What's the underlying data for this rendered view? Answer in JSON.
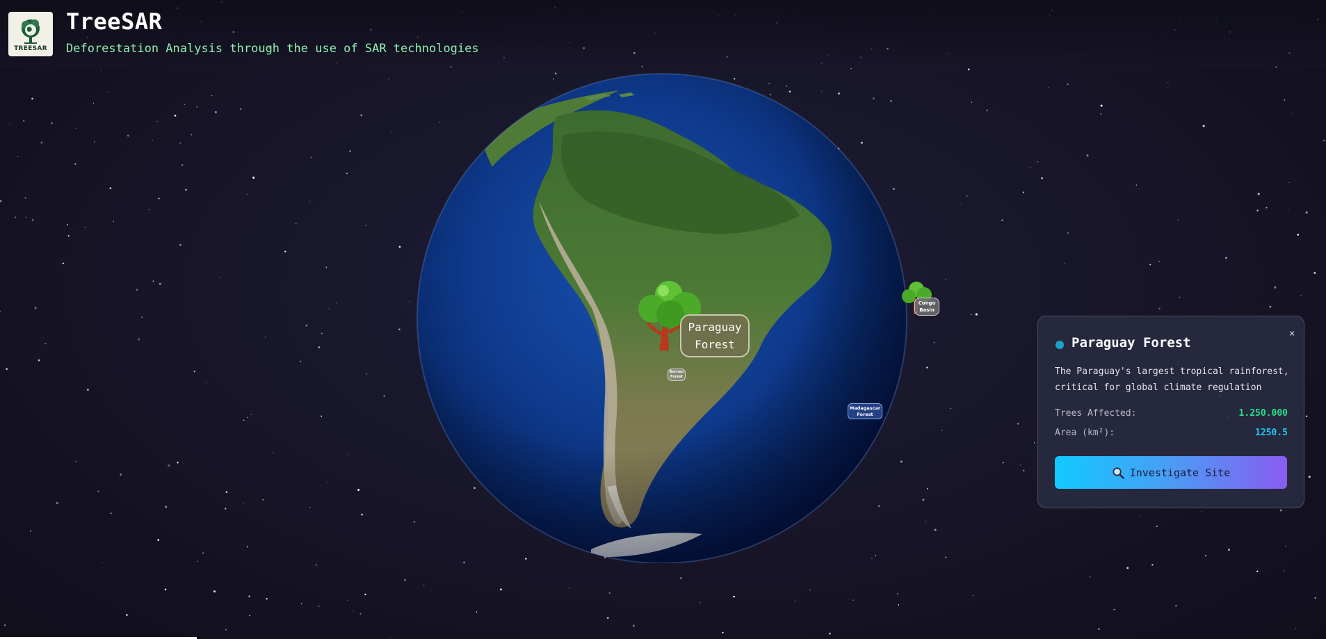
{
  "header": {
    "logo_text": "TREESAR",
    "title": "TreeSAR",
    "subtitle": "Deforestation Analysis through the use of SAR technologies"
  },
  "globe": {
    "labels": {
      "paraguay": "Paraguay\nForest",
      "borneo": "Borneo\nForest",
      "congo": "Congo\nBasin",
      "madagascar": "Madagascar\nForest"
    }
  },
  "panel": {
    "title": "Paraguay Forest",
    "close": "×",
    "description": "The Paraguay's largest tropical rainforest, critical for global climate regulation",
    "trees_label": "Trees Affected:",
    "trees_value": "1.250.000",
    "area_label": "Area (km²):",
    "area_value": "1250.5",
    "button_label": "Investigate Site",
    "button_icon": "magnifier-icon"
  },
  "colors": {
    "accent_green": "#24e08a",
    "accent_cyan": "#1ec8f0",
    "subtitle_green": "#8ff0b0",
    "button_gradient_start": "#12c9ff",
    "button_gradient_end": "#8a5cf0",
    "ocean": "#0e3a8c"
  }
}
